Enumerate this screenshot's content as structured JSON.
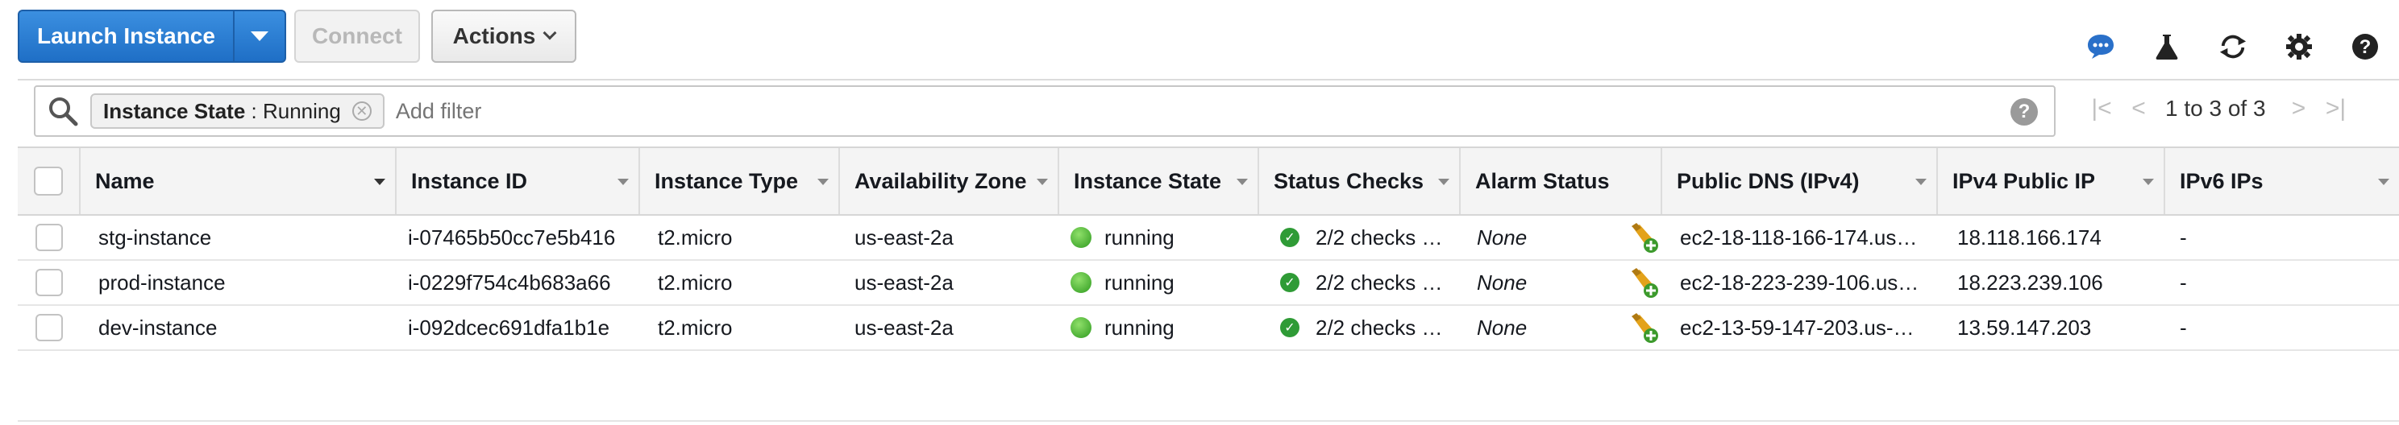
{
  "toolbar": {
    "launch_label": "Launch Instance",
    "connect_label": "Connect",
    "actions_label": "Actions"
  },
  "top_icons": [
    "chat-icon",
    "flask-icon",
    "refresh-icon",
    "gear-icon",
    "help-icon"
  ],
  "filter": {
    "token_key": "Instance State",
    "token_sep": " : ",
    "token_value": "Running",
    "placeholder": "Add filter"
  },
  "pager": {
    "text": "1 to 3 of 3"
  },
  "columns": [
    "Name",
    "Instance ID",
    "Instance Type",
    "Availability Zone",
    "Instance State",
    "Status Checks",
    "Alarm Status",
    "Public DNS (IPv4)",
    "IPv4 Public IP",
    "IPv6 IPs"
  ],
  "rows": [
    {
      "name": "stg-instance",
      "id": "i-07465b50cc7e5b416",
      "type": "t2.micro",
      "zone": "us-east-2a",
      "state": "running",
      "checks": "2/2 checks …",
      "alarm": "None",
      "dns": "ec2-18-118-166-174.us…",
      "ip": "18.118.166.174",
      "ipv6": "-"
    },
    {
      "name": "prod-instance",
      "id": "i-0229f754c4b683a66",
      "type": "t2.micro",
      "zone": "us-east-2a",
      "state": "running",
      "checks": "2/2 checks …",
      "alarm": "None",
      "dns": "ec2-18-223-239-106.us…",
      "ip": "18.223.239.106",
      "ipv6": "-"
    },
    {
      "name": "dev-instance",
      "id": "i-092dcec691dfa1b1e",
      "type": "t2.micro",
      "zone": "us-east-2a",
      "state": "running",
      "checks": "2/2 checks …",
      "alarm": "None",
      "dns": "ec2-13-59-147-203.us-…",
      "ip": "13.59.147.203",
      "ipv6": "-"
    }
  ],
  "colors": {
    "primary": "#1f6fc6",
    "running": "#2e9a1f",
    "ok": "#2f9b36"
  }
}
